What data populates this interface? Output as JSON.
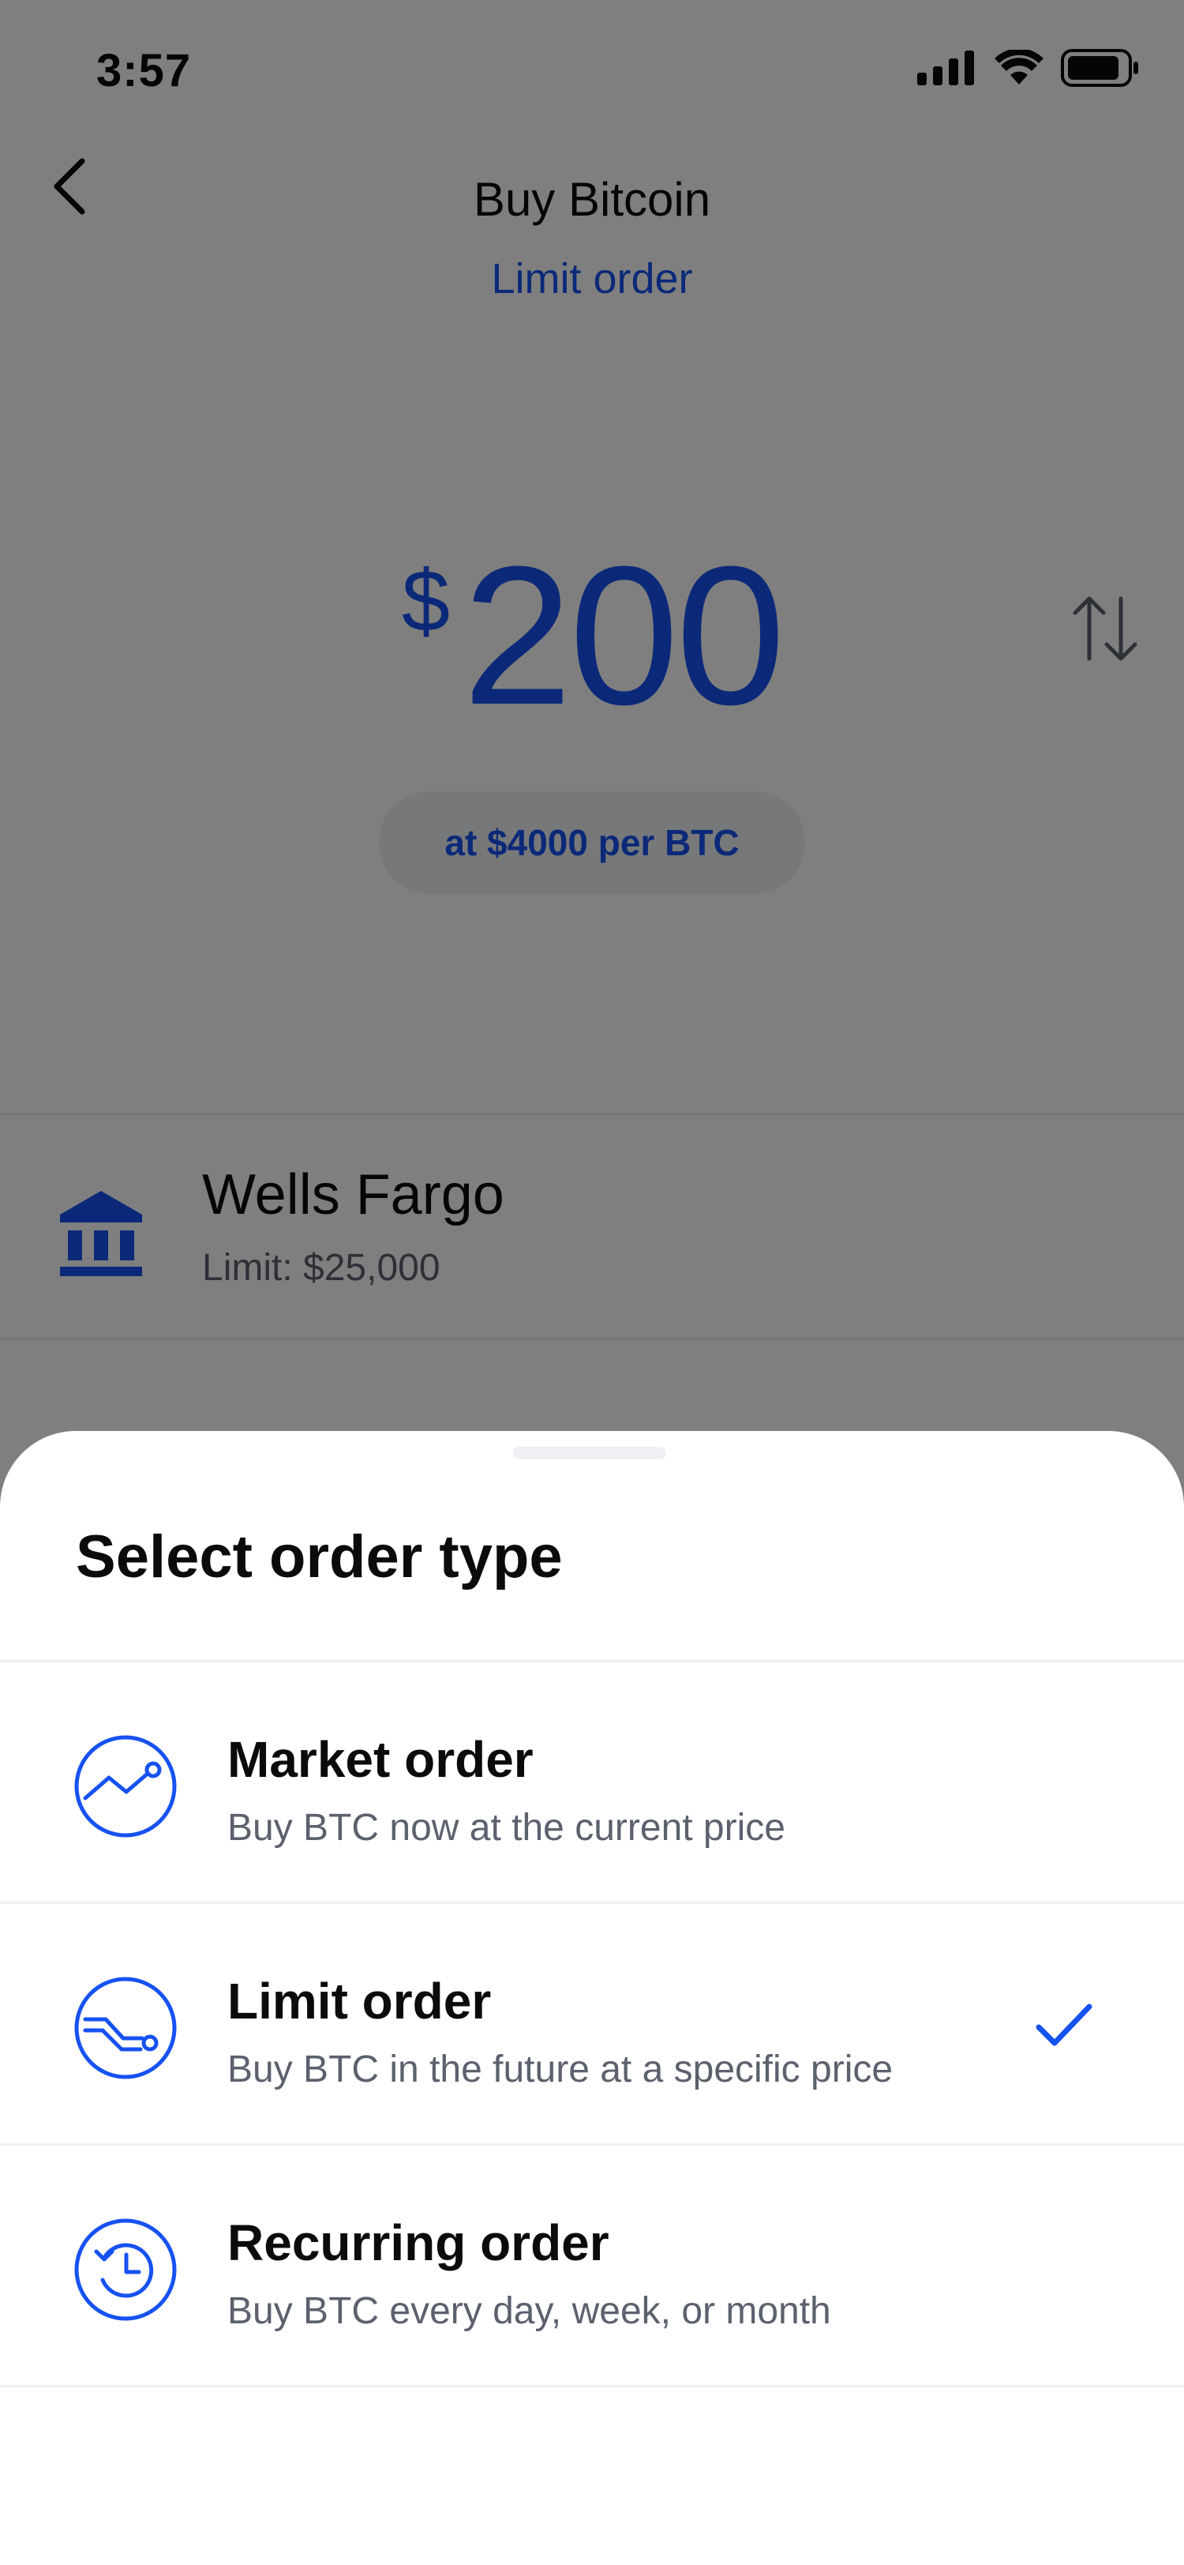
{
  "status_bar": {
    "time": "3:57"
  },
  "header": {
    "title": "Buy Bitcoin",
    "subtitle": "Limit order"
  },
  "amount": {
    "currency_symbol": "$",
    "value": "200",
    "price_label": "at $4000 per BTC"
  },
  "payment_method": {
    "name": "Wells Fargo",
    "limit": "Limit: $25,000"
  },
  "order_sheet": {
    "title": "Select order type",
    "options": [
      {
        "title": "Market order",
        "description": "Buy BTC now at the current price",
        "icon": "market-chart-icon",
        "selected": false
      },
      {
        "title": "Limit order",
        "description": "Buy BTC in the future at a specific price",
        "icon": "limit-chart-icon",
        "selected": true
      },
      {
        "title": "Recurring order",
        "description": "Buy BTC every day, week, or month",
        "icon": "recurring-clock-icon",
        "selected": false
      }
    ]
  },
  "colors": {
    "accent": "#1652f0",
    "text": "#0a0b0d",
    "muted": "#5b616e",
    "overlay": "rgba(0,0,0,0.5)"
  }
}
